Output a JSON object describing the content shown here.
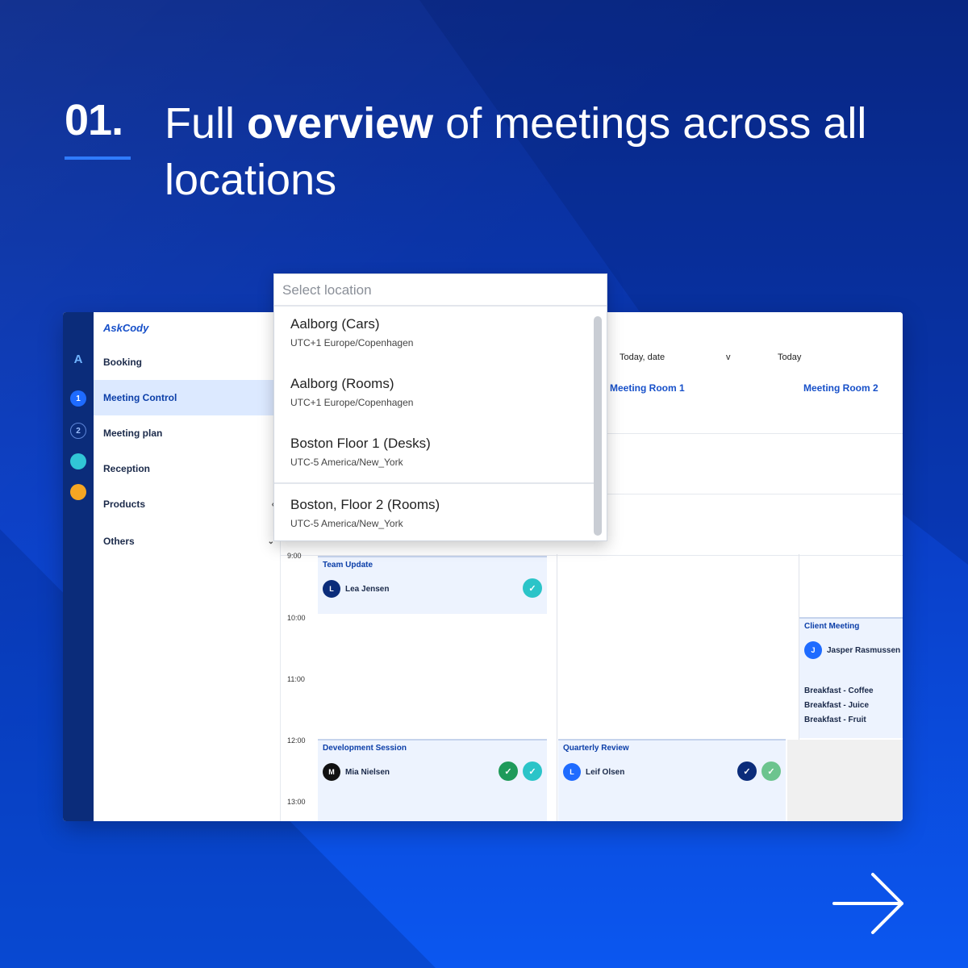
{
  "headline": {
    "number": "01.",
    "title_prefix": "Full ",
    "title_bold": "overview",
    "title_suffix": " of meetings across all locations"
  },
  "rail": {
    "items": [
      "A",
      "1",
      "2",
      "",
      ""
    ]
  },
  "sidebar": {
    "brand": "AskCody",
    "items": [
      {
        "label": "Booking",
        "chevron": ""
      },
      {
        "label": "Meeting Control",
        "chevron": ""
      },
      {
        "label": "Meeting plan",
        "chevron": ""
      },
      {
        "label": "Reception",
        "chevron": ""
      },
      {
        "label": "Products",
        "chevron": "‹"
      },
      {
        "label": "Others",
        "chevron": "⌄"
      }
    ]
  },
  "main": {
    "topbar": [
      "Today, date",
      "v",
      "Today"
    ],
    "columns": [
      "Meeting Room 1",
      "Meeting Room 2"
    ],
    "times": [
      "9:00",
      "10:00",
      "11:00",
      "12:00",
      "13:00"
    ],
    "cards": [
      {
        "title": "Team Update",
        "user": "Lea Jensen",
        "avatar_letter": "L",
        "icons": [
          "✓"
        ]
      },
      {
        "title": "Client Meeting",
        "user": "Jasper Rasmussen",
        "avatar_letter": "J",
        "notes": [
          "Breakfast - Coffee",
          "Breakfast - Juice",
          "Breakfast - Fruit"
        ]
      },
      {
        "title": "Development Session",
        "user": "Mia Nielsen",
        "avatar_letter": "M",
        "icons": [
          "✓",
          "✓"
        ]
      },
      {
        "title": "Quarterly Review",
        "user": "Leif Olsen",
        "avatar_letter": "L",
        "icons": [
          "✓",
          "✓"
        ]
      }
    ]
  },
  "dropdown": {
    "placeholder": "Select location",
    "options": [
      {
        "name": "Aalborg (Cars)",
        "tz": "UTC+1 Europe/Copenhagen"
      },
      {
        "name": "Aalborg (Rooms)",
        "tz": "UTC+1 Europe/Copenhagen"
      },
      {
        "name": "Boston Floor 1 (Desks)",
        "tz": "UTC-5 America/New_York"
      },
      {
        "name": "Boston, Floor 2 (Rooms)",
        "tz": "UTC-5 America/New_York"
      }
    ]
  },
  "colors": {
    "accent": "#1750c9",
    "background_top": "#0a2a8c",
    "background_bottom": "#0b57f0",
    "teal": "#2bc4c8",
    "green": "#1f9a5a"
  },
  "icons": {
    "next": "arrow-right-icon"
  }
}
